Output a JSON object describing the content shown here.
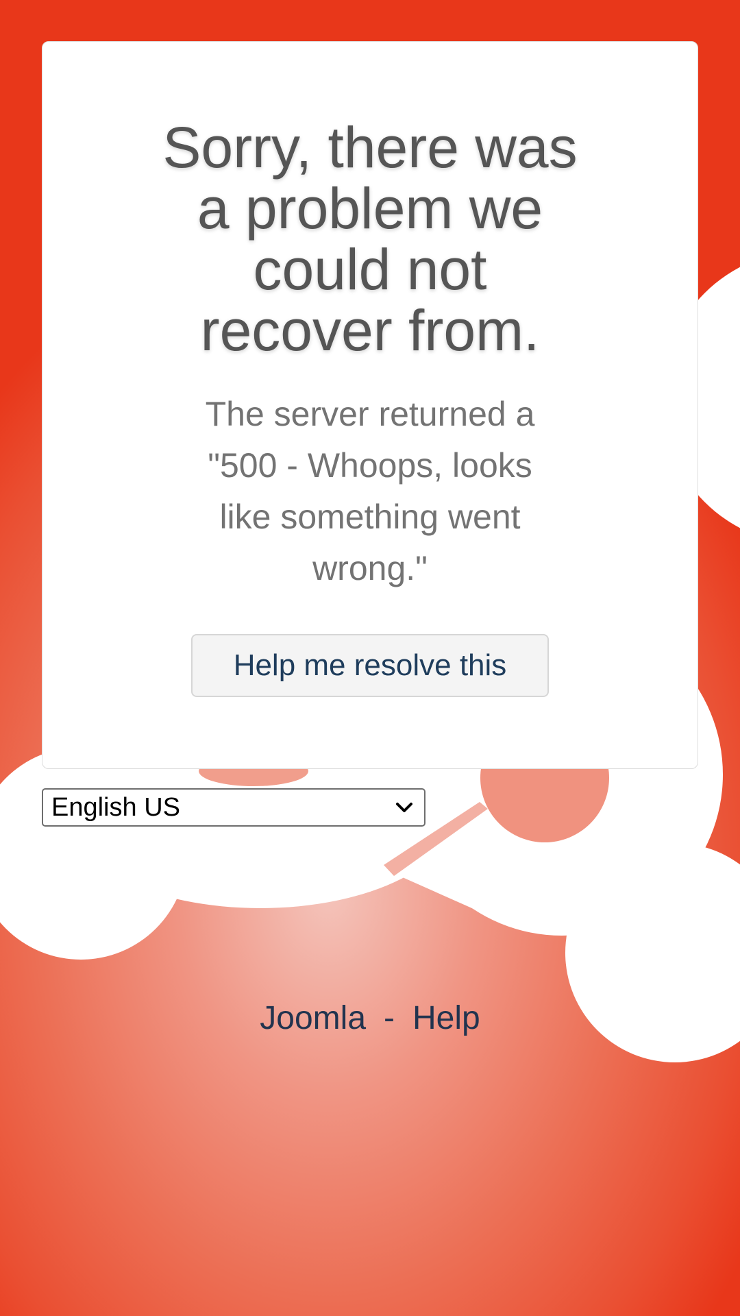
{
  "error": {
    "title": "Sorry, there was a problem we could not recover from.",
    "message": "The server returned a \"500 - Whoops, looks like something went wrong.\"",
    "help_button_label": "Help me resolve this"
  },
  "language": {
    "selected": "English US"
  },
  "footer": {
    "links": [
      "Joomla",
      "Help"
    ],
    "separator": "-"
  },
  "colors": {
    "background_accent": "#ea4f32",
    "link": "#22344f",
    "title": "#555555"
  },
  "icons": {
    "select_arrow": "chevron-down-icon",
    "background": "joomla-logo-watermark"
  }
}
